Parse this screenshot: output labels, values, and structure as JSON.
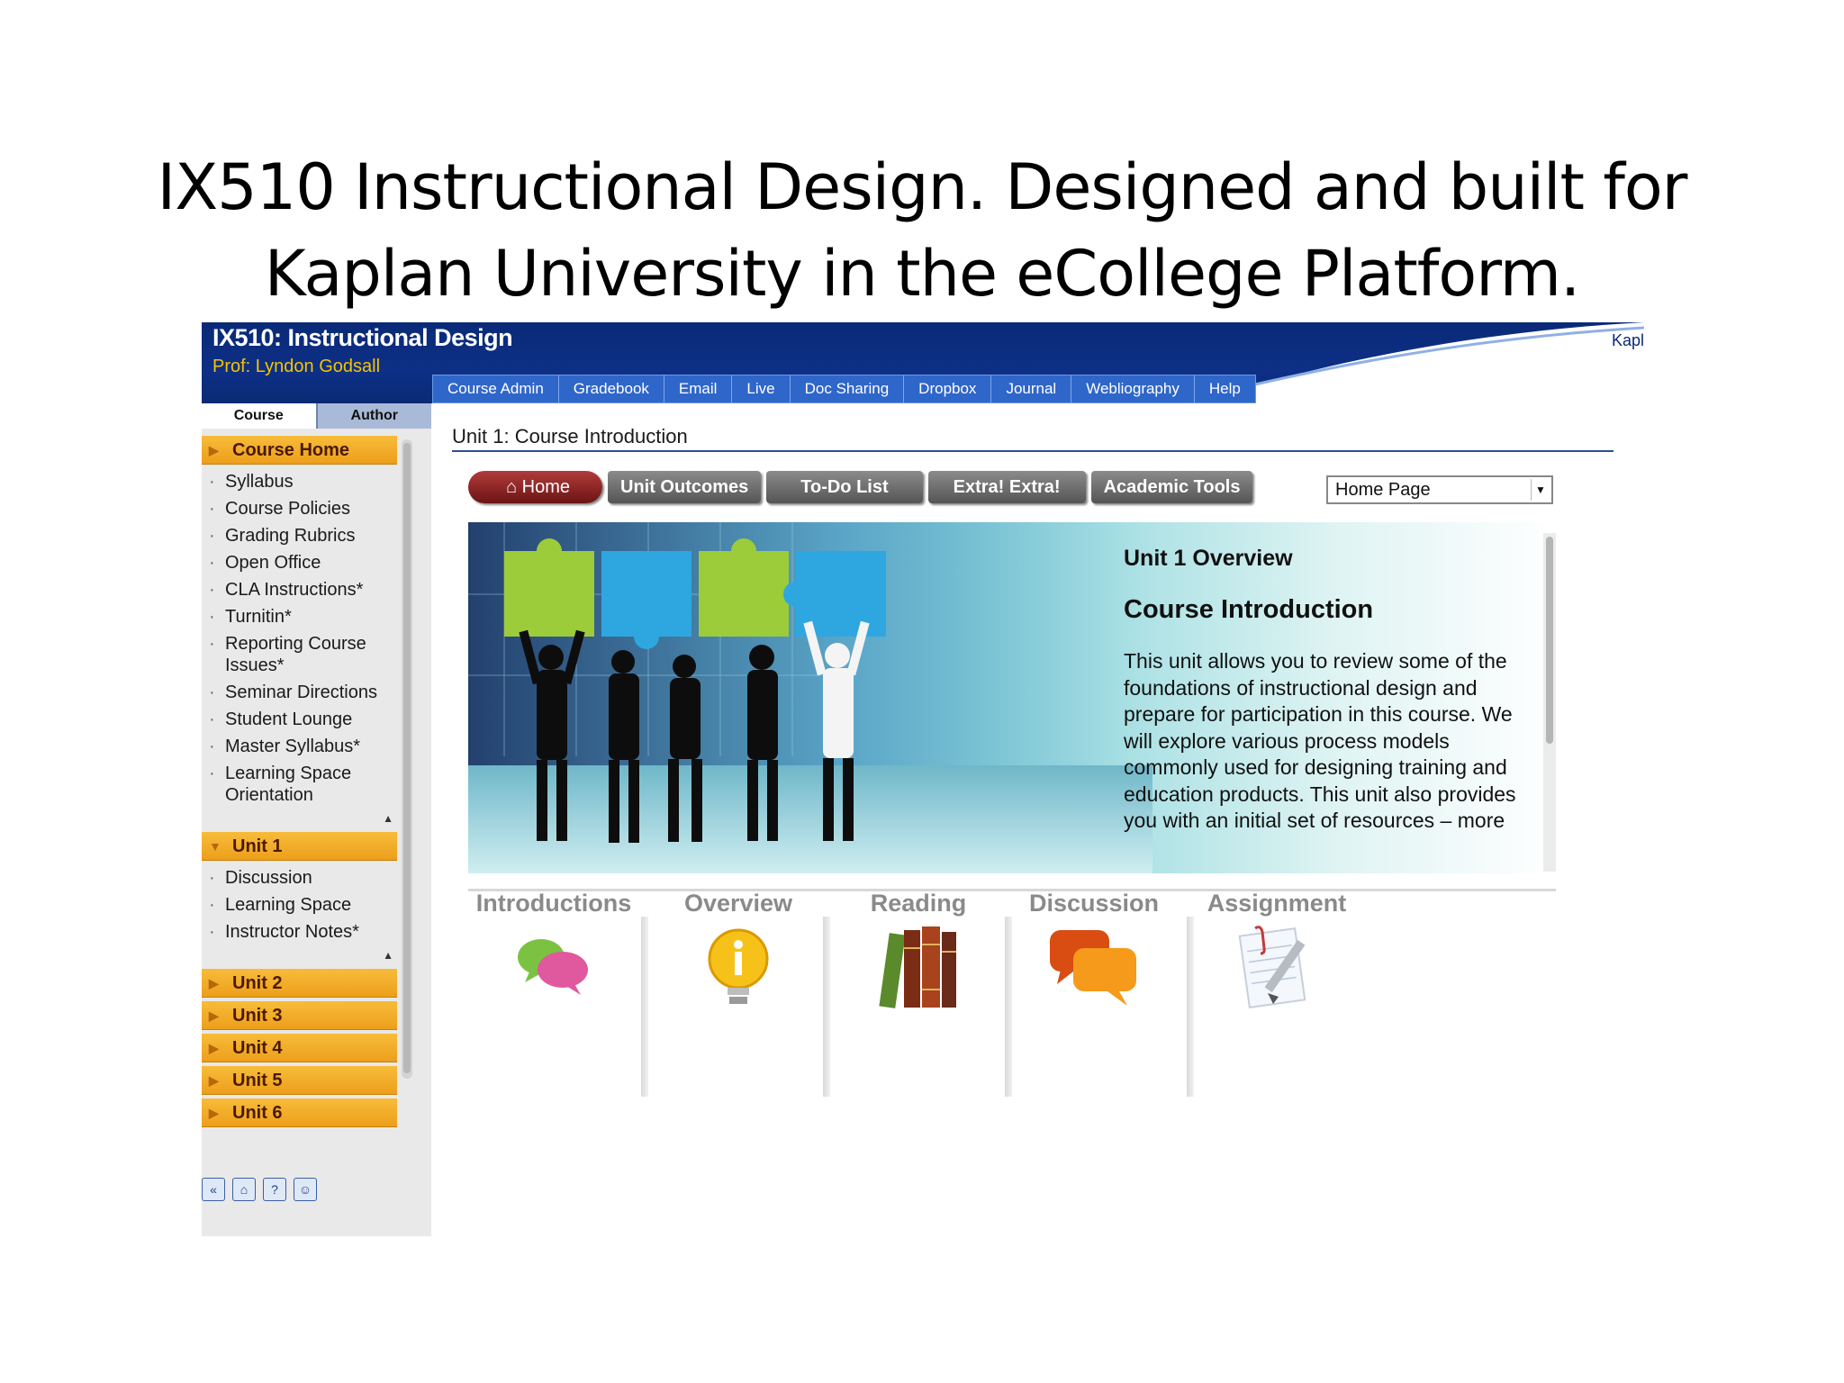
{
  "slide": {
    "title_line1": "IX510 Instructional Design.  Designed and built for",
    "title_line2": "Kaplan University in the eCollege Platform."
  },
  "header": {
    "course_title": "IX510: Instructional Design",
    "professor": "Prof:  Lyndon Godsall",
    "brand_partial": "Kapl",
    "nav": [
      "Course Admin",
      "Gradebook",
      "Email",
      "Live",
      "Doc Sharing",
      "Dropbox",
      "Journal",
      "Webliography",
      "Help"
    ]
  },
  "sidebar": {
    "tabs": [
      "Course",
      "Author"
    ],
    "course_home": {
      "label": "Course Home",
      "items": [
        "Syllabus",
        "Course Policies",
        "Grading Rubrics",
        "Open Office",
        "CLA Instructions*",
        "Turnitin*",
        "Reporting Course Issues*",
        "Seminar Directions",
        "Student Lounge",
        "Master Syllabus*",
        "Learning Space Orientation"
      ]
    },
    "unit1": {
      "label": "Unit 1",
      "items": [
        "Discussion",
        "Learning Space",
        "Instructor Notes*"
      ]
    },
    "collapsed_units": [
      "Unit 2",
      "Unit 3",
      "Unit 4",
      "Unit 5",
      "Unit 6"
    ],
    "tool_icons": [
      "collapse-icon",
      "home-icon",
      "help-icon",
      "user-icon"
    ]
  },
  "content": {
    "unit_title": "Unit 1: Course Introduction",
    "tabs": {
      "home": "Home",
      "unit_outcomes": "Unit Outcomes",
      "todo": "To-Do List",
      "extra": "Extra! Extra!",
      "academic_tools": "Academic Tools"
    },
    "page_select": "Home Page",
    "banner": {
      "overview": "Unit 1 Overview",
      "heading": "Course Introduction",
      "body": "This unit allows you to review some of the foundations of instructional design and prepare for participation in this course. We will explore various process models commonly used for designing training and education products. This unit also provides you with an initial set of resources – more"
    },
    "activities": [
      "Introductions",
      "Overview",
      "Reading",
      "Discussion",
      "Assignment"
    ]
  },
  "colors": {
    "header_blue": "#0d2f86",
    "nav_blue": "#2f66c9",
    "section_orange": "#f0a626",
    "home_tab_red": "#8f2424",
    "tab_gray": "#6e6e6e"
  }
}
